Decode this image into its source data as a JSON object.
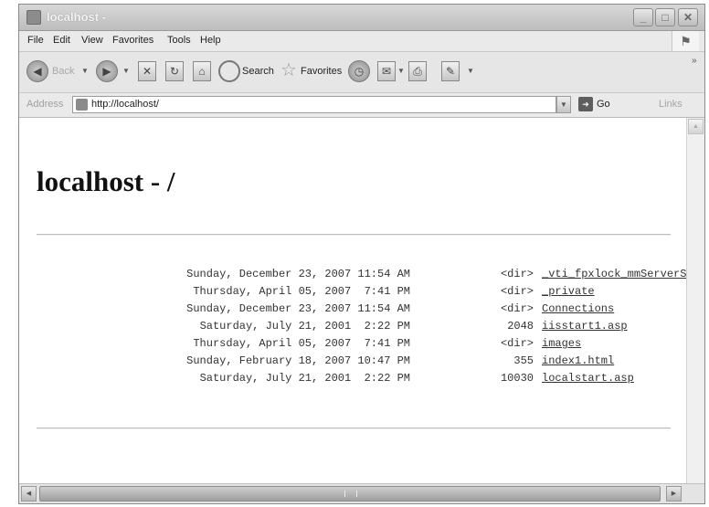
{
  "window": {
    "title": "localhost -",
    "controls": {
      "minimize": "_",
      "maximize": "□",
      "close": "✕"
    }
  },
  "menu": [
    {
      "label": "File",
      "name": "menu-file"
    },
    {
      "label": "Edit",
      "name": "menu-edit"
    },
    {
      "label": "View",
      "name": "menu-view"
    },
    {
      "label": "Favorites",
      "name": "menu-favorites"
    },
    {
      "label": "Tools",
      "name": "menu-tools"
    },
    {
      "label": "Help",
      "name": "menu-help"
    }
  ],
  "toolbar": {
    "back_label": "Back",
    "search_label": "Search",
    "favorites_label": "Favorites"
  },
  "address": {
    "label": "Address",
    "url": "http://localhost/",
    "go_label": "Go",
    "links_label": "Links"
  },
  "page": {
    "title": "localhost - /",
    "listing": [
      {
        "date": "Sunday, December 23, 2007 11:54 AM",
        "size": "<dir>",
        "name": "_vti_fpxlock_mmServerScripts"
      },
      {
        "date": "Thursday, April 05, 2007  7:41 PM",
        "size": "<dir>",
        "name": "_private"
      },
      {
        "date": "Sunday, December 23, 2007 11:54 AM",
        "size": "<dir>",
        "name": "Connections"
      },
      {
        "date": "Saturday, July 21, 2001  2:22 PM",
        "size": "2048",
        "name": "iisstart1.asp"
      },
      {
        "date": "Thursday, April 05, 2007  7:41 PM",
        "size": "<dir>",
        "name": "images"
      },
      {
        "date": "Sunday, February 18, 2007 10:47 PM",
        "size": "355",
        "name": "index1.html"
      },
      {
        "date": "Saturday, July 21, 2001  2:22 PM",
        "size": "10030",
        "name": "localstart.asp"
      }
    ]
  }
}
